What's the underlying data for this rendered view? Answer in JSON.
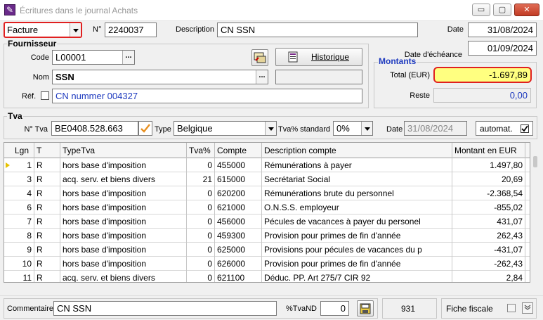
{
  "window": {
    "title": "Écritures dans le journal Achats",
    "buttons": {
      "minimize": "▭",
      "maximize": "▢",
      "close": "✕"
    }
  },
  "header": {
    "doc_type": "Facture",
    "number_label": "N°",
    "number_value": "2240037",
    "description_label": "Description",
    "description_value": "CN SSN",
    "date_label": "Date",
    "date_value": "31/08/2024",
    "due_label": "Date d'échéance",
    "due_value": "01/09/2024"
  },
  "supplier": {
    "group_title": "Fournisseur",
    "code_label": "Code",
    "code_value": "L00001",
    "name_label": "Nom",
    "name_value": "SSN",
    "ref_label": "Réf.",
    "ref_value": "CN nummer 004327",
    "history_button": "Historique"
  },
  "amounts": {
    "group_title": "Montants",
    "total_label": "Total (EUR)",
    "total_value": "-1.697,89",
    "rest_label": "Reste",
    "rest_value": "0,00"
  },
  "vat": {
    "group_title": "Tva",
    "number_label": "N° Tva",
    "number_value": "BE0408.528.663",
    "type_label": "Type",
    "type_value": "Belgique",
    "standard_label": "Tva% standard",
    "standard_value": "0%",
    "date_label": "Date",
    "date_value": "31/08/2024",
    "auto_label": "automat."
  },
  "table": {
    "columns": [
      "Lgn",
      "T",
      "TypeTva",
      "Tva%",
      "Compte",
      "Description compte",
      "Montant en EUR"
    ],
    "rows": [
      [
        "1",
        "R",
        "hors base d'imposition",
        "0",
        "455000",
        "Rémunérations à payer",
        "1.497,80"
      ],
      [
        "3",
        "R",
        "acq. serv. et biens divers",
        "21",
        "615000",
        "Secrétariat Social",
        "20,69"
      ],
      [
        "4",
        "R",
        "hors base d'imposition",
        "0",
        "620200",
        "Rémunérations brute du personnel",
        "-2.368,54"
      ],
      [
        "6",
        "R",
        "hors base d'imposition",
        "0",
        "621000",
        "O.N.S.S. employeur",
        "-855,02"
      ],
      [
        "7",
        "R",
        "hors base d'imposition",
        "0",
        "456000",
        "Pécules de vacances à payer du personel",
        "431,07"
      ],
      [
        "8",
        "R",
        "hors base d'imposition",
        "0",
        "459300",
        "Provision pour primes de fin d'année",
        "262,43"
      ],
      [
        "9",
        "R",
        "hors base d'imposition",
        "0",
        "625000",
        "Provisions pour pécules de vacances du p",
        "-431,07"
      ],
      [
        "10",
        "R",
        "hors base d'imposition",
        "0",
        "626000",
        "Provision pour primes de fin d'année",
        "-262,43"
      ],
      [
        "11",
        "R",
        "acq. serv. et biens divers",
        "0",
        "621100",
        "Déduc. PP. Art 275/7 CIR 92",
        "2,84"
      ]
    ]
  },
  "footer": {
    "comment_label": "Commentaire",
    "comment_value": "CN SSN",
    "tvand_label": "%TvaND",
    "tvand_value": "0",
    "count_value": "931",
    "fiche_label": "Fiche fiscale"
  },
  "colors": {
    "highlight_border": "#e02020",
    "total_bg": "#ffff80",
    "blue_text": "#1f3bbf",
    "title_gray": "#999999"
  }
}
